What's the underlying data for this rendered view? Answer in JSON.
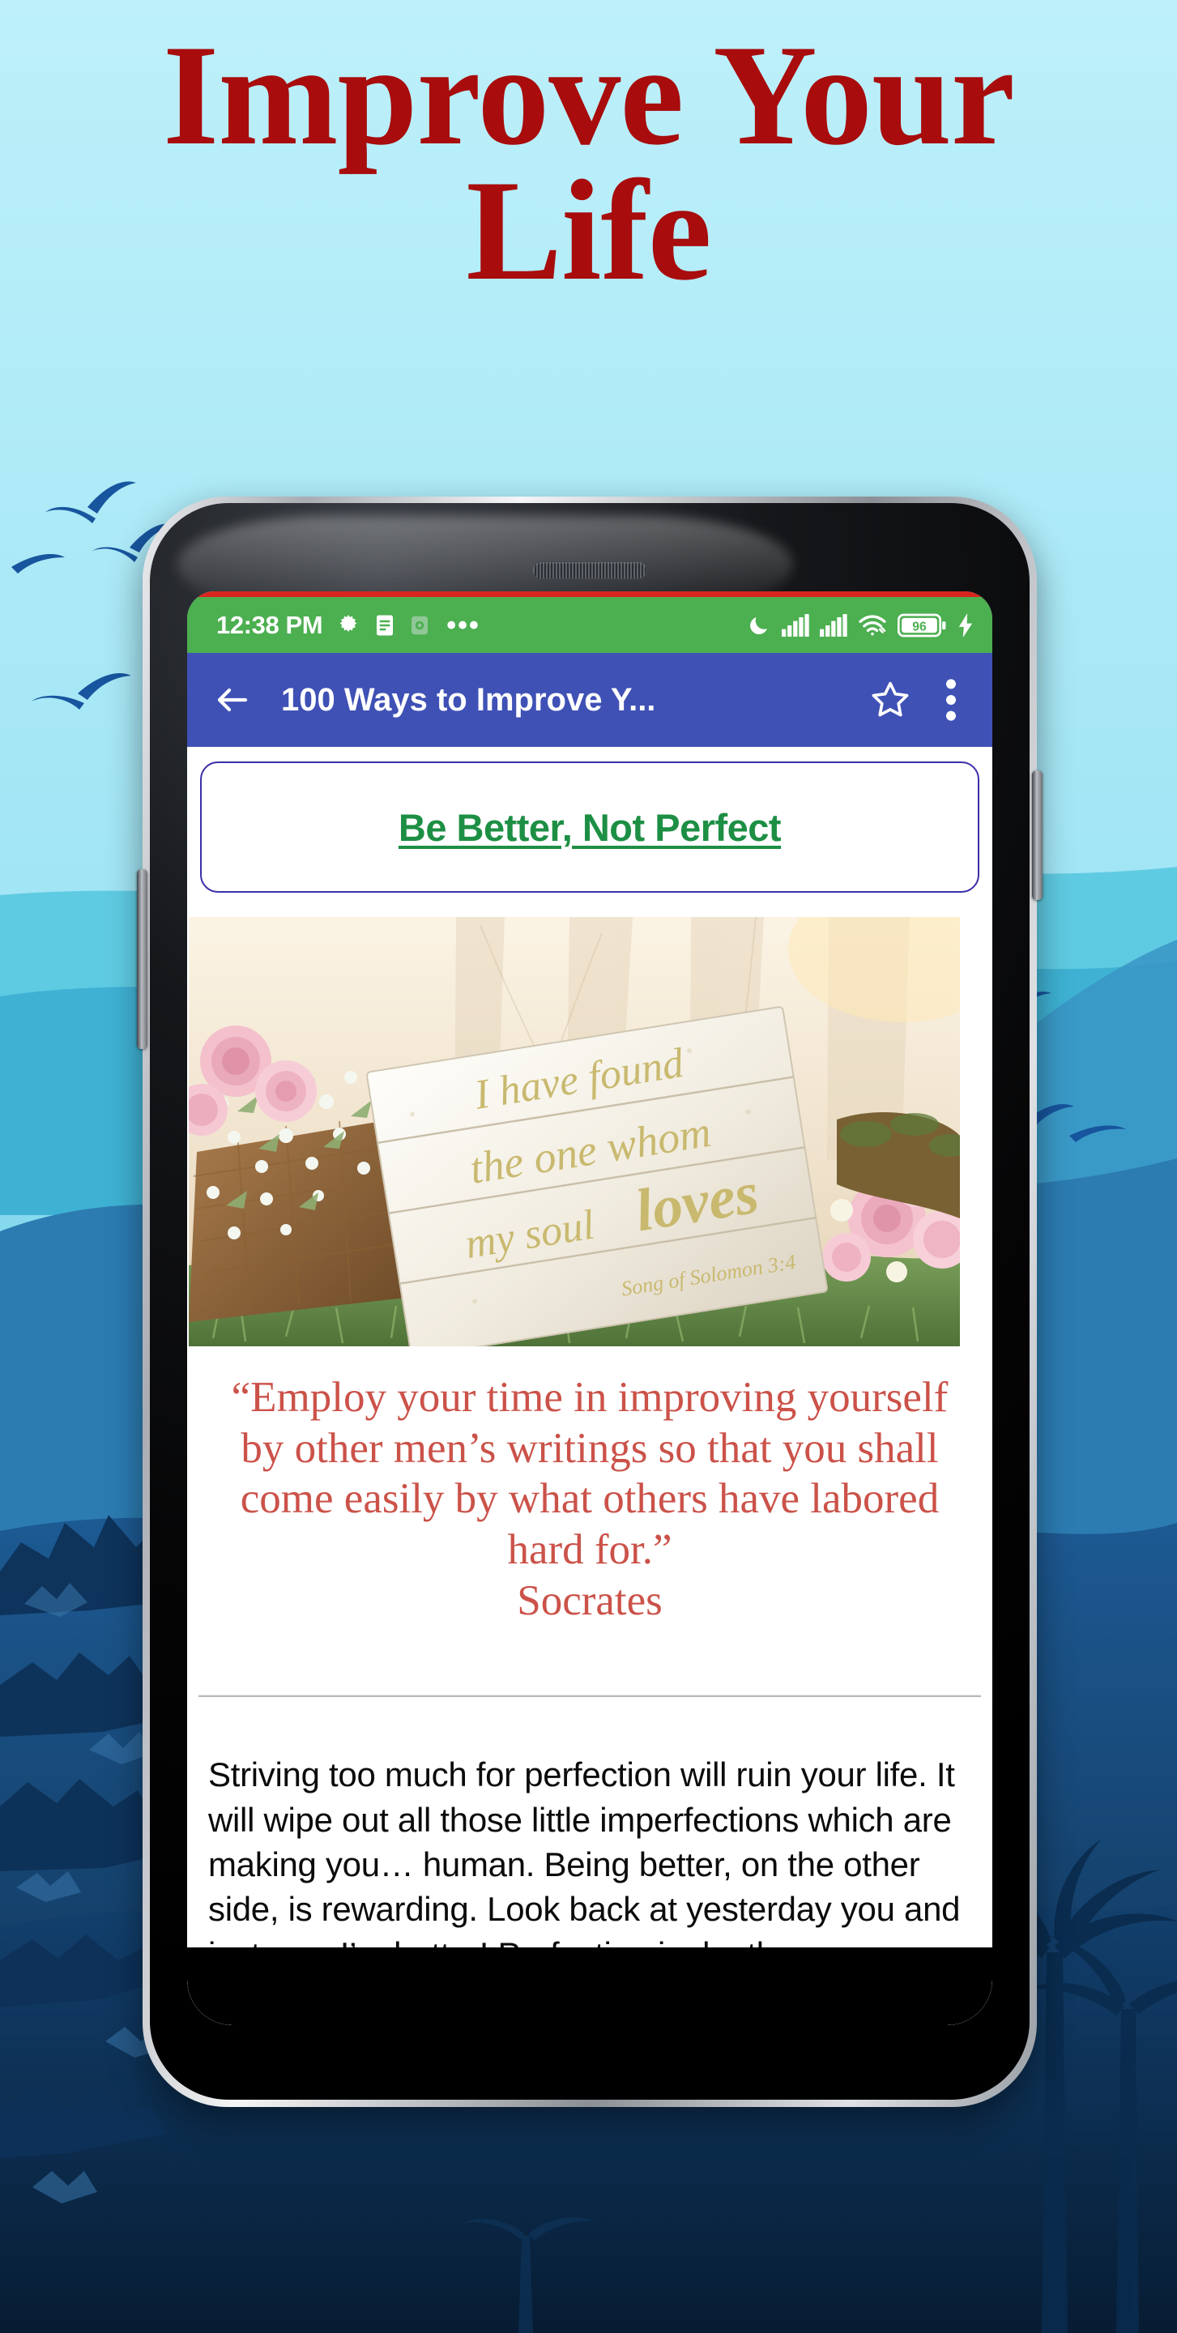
{
  "promo": {
    "line1": "Improve Your",
    "line2": "Life",
    "color": "#a80c0c"
  },
  "background": {
    "sky_color": "#b5ecf7",
    "hill_mid_color": "#4bc4de",
    "hill_dark_color": "#2f7fb5",
    "hill_deep_color": "#123a63",
    "bird_color": "#17559e"
  },
  "phone": {
    "status_bar": {
      "background": "#4caf50",
      "time": "12:38 PM",
      "left_icons": [
        "gear-icon",
        "document-icon",
        "camera-icon"
      ],
      "overflow_dots": "•••",
      "right_icons": [
        "moon-icon",
        "signal-icon",
        "signal-icon",
        "wifi-icon"
      ],
      "battery_level": "96",
      "charging": true
    },
    "app_bar": {
      "background": "#3f51b5",
      "back_label": "back-arrow",
      "title": "100 Ways to Improve Y...",
      "favorite_label": "star-outline",
      "overflow_label": "more-vertical"
    },
    "article": {
      "title": "Be Better, Not Perfect",
      "title_color": "#1d8f44",
      "card_border_color": "#3b2fa8",
      "photo": {
        "alt": "Wooden wedding sign with pink roses and baby's breath on grass",
        "sign_line1": "I have found",
        "sign_line2": "the one whom",
        "sign_line3": "my soul",
        "sign_word_loves": "loves",
        "sign_attribution": "Song of Solomon 3:4"
      },
      "quote": "“Employ your time in improving yourself by other men’s writings so that you shall come easily by what others have labored hard for.”",
      "quote_author": "Socrates",
      "quote_color": "#cb5249",
      "body": "Striving too much for perfection will ruin your life. It will wipe out all those little imperfections which are making you… human. Being better, on the other side, is rewarding. Look back at yesterday you and just say: I’m better! Perfection is death camouflaged in beauty. You can’t really be perfect and still be alive. Your life is made out of all those little limitations, all those spots on your immaculate canvas. Eliminating them will"
    }
  }
}
